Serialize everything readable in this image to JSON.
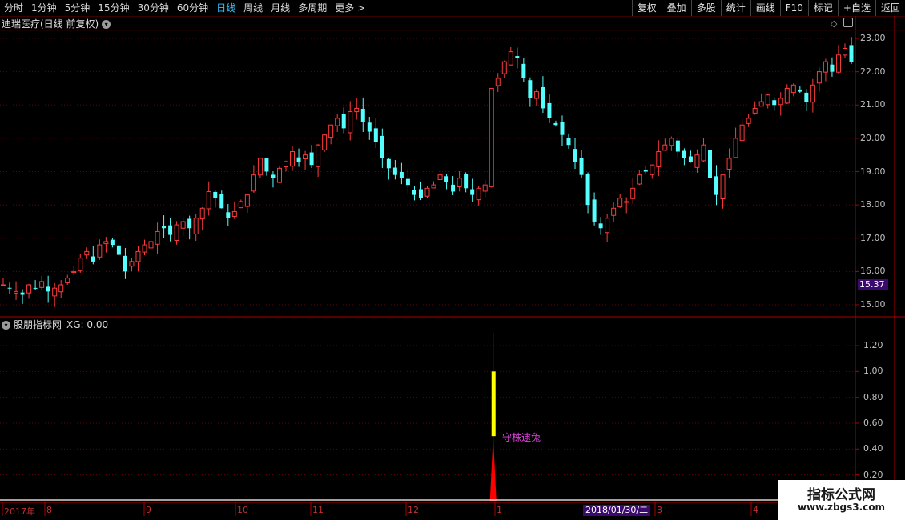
{
  "toolbar": {
    "periods": [
      "分时",
      "1分钟",
      "5分钟",
      "15分钟",
      "30分钟",
      "60分钟",
      "日线",
      "周线",
      "月线",
      "多周期",
      "更多 >"
    ],
    "active": "日线",
    "actions": [
      "复权",
      "叠加",
      "多股",
      "统计",
      "画线",
      "F10",
      "标记",
      "+自选",
      "返回"
    ]
  },
  "main_panel": {
    "title": "迪瑞医疗(日线 前复权)",
    "last_price": "15.37",
    "y_ticks": [
      "23.00",
      "22.00",
      "21.00",
      "20.00",
      "19.00",
      "18.00",
      "17.00",
      "16.00",
      "15.00"
    ]
  },
  "indicator_panel": {
    "title": "股朋指标网",
    "xg_label": "XG: 0.00",
    "y_ticks": [
      "1.20",
      "1.00",
      "0.80",
      "0.60",
      "0.40",
      "0.20"
    ],
    "annotation": "守株逮兔"
  },
  "x_axis": {
    "labels": [
      "2017年",
      "8",
      "9",
      "10",
      "11",
      "12",
      "1",
      "3",
      "4"
    ],
    "cursor_date": "2018/01/30/二"
  },
  "watermark": {
    "line1": "指标公式网",
    "line2": "www.zbgs3.com"
  },
  "colors": {
    "up": "#ff3b3b",
    "down": "#54ffff",
    "grid": "#6a0000",
    "axis": "#b00000",
    "signal_yellow": "#ffff00",
    "signal_red": "#ff0000",
    "annotation": "#e040e0",
    "label_bg": "#3a0a6e"
  },
  "chart_data": {
    "type": "candlestick",
    "ylim": [
      15.0,
      23.0
    ],
    "close_series": [
      15.6,
      15.5,
      15.4,
      15.3,
      15.6,
      15.5,
      15.7,
      15.4,
      15.5,
      15.6,
      15.8,
      16.0,
      16.4,
      16.6,
      16.3,
      16.8,
      16.9,
      16.8,
      16.5,
      16.0,
      16.3,
      16.6,
      16.8,
      16.9,
      17.2,
      17.3,
      17.1,
      17.4,
      17.5,
      17.3,
      17.6,
      17.9,
      18.4,
      18.2,
      17.9,
      17.6,
      17.8,
      18.1,
      18.3,
      18.9,
      19.4,
      19.0,
      18.8,
      19.1,
      19.3,
      19.6,
      19.3,
      19.5,
      19.2,
      19.8,
      20.1,
      20.4,
      20.6,
      20.3,
      20.8,
      20.9,
      20.5,
      20.2,
      19.9,
      19.4,
      19.1,
      18.9,
      18.8,
      18.6,
      18.3,
      18.2,
      18.5,
      18.6,
      18.9,
      18.7,
      18.4,
      18.8,
      18.5,
      18.3,
      18.5,
      18.6,
      21.5,
      21.8,
      22.3,
      22.6,
      22.4,
      21.8,
      21.2,
      21.4,
      20.9,
      20.6,
      20.4,
      20.1,
      19.8,
      19.3,
      18.9,
      18.0,
      17.5,
      17.3,
      17.6,
      17.9,
      18.2,
      18.1,
      18.5,
      18.9,
      19.0,
      19.2,
      19.6,
      19.8,
      20.0,
      19.6,
      19.4,
      19.3,
      19.5,
      19.8,
      18.8,
      18.3,
      18.9,
      19.4,
      20.0,
      20.4,
      20.6,
      20.9,
      21.1,
      21.3,
      21.0,
      21.2,
      21.5,
      21.6,
      21.4,
      21.1,
      21.6,
      22.0,
      22.3,
      22.0,
      22.5,
      22.7,
      22.3
    ],
    "indicator": {
      "series": [
        {
          "name": "XG",
          "peak_index": 76,
          "peak_value": 1.0,
          "mid_value": 0.5,
          "spike_high": 1.3
        }
      ],
      "ylim": [
        0,
        1.4
      ]
    }
  }
}
